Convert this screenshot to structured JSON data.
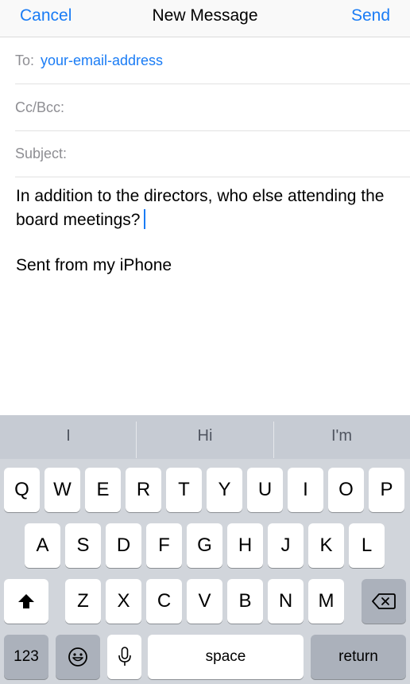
{
  "nav": {
    "cancel": "Cancel",
    "title": "New Message",
    "send": "Send"
  },
  "fields": {
    "to_label": "To:",
    "to_value": "your-email-address",
    "cc_label": "Cc/Bcc:",
    "subject_label": "Subject:"
  },
  "body": {
    "text": "In addition to the directors, who else attending the board meetings?",
    "signature": "Sent from my iPhone"
  },
  "keyboard": {
    "suggestions": [
      "I",
      "Hi",
      "I'm"
    ],
    "row1": [
      "Q",
      "W",
      "E",
      "R",
      "T",
      "Y",
      "U",
      "I",
      "O",
      "P"
    ],
    "row2": [
      "A",
      "S",
      "D",
      "F",
      "G",
      "H",
      "J",
      "K",
      "L"
    ],
    "row3": [
      "Z",
      "X",
      "C",
      "V",
      "B",
      "N",
      "M"
    ],
    "numbers_label": "123",
    "space_label": "space",
    "return_label": "return",
    "shift_icon": "shift-icon",
    "delete_icon": "backspace-icon",
    "emoji_icon": "emoji-icon",
    "mic_icon": "microphone-icon"
  },
  "colors": {
    "accent": "#1a7cf5",
    "keyboard_bg": "#d1d5db"
  }
}
